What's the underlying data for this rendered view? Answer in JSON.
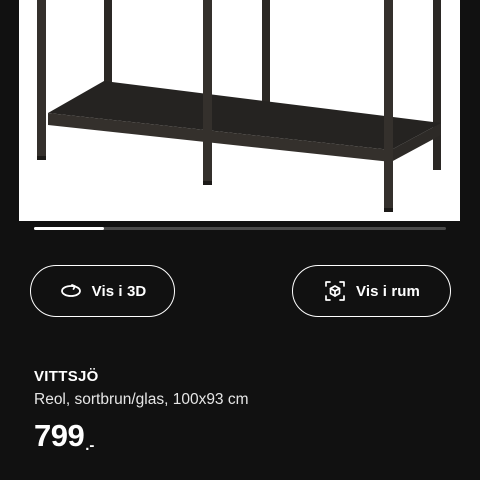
{
  "gallery": {
    "image_alt": "VITTSJÖ shelving unit",
    "progress": 0.17
  },
  "actions": {
    "view_3d": {
      "label": "Vis i 3D",
      "icon": "rotate-3d-icon"
    },
    "view_room": {
      "label": "Vis i rum",
      "icon": "ar-room-icon"
    }
  },
  "product": {
    "name": "VITTSJÖ",
    "description": "Reol, sortbrun/glas, 100x93 cm",
    "price_main": "799",
    "price_suffix": ".-"
  },
  "colors": {
    "background": "#111111",
    "text": "#ffffff",
    "frame": "#2a2724",
    "shelf": "#1f1d1b"
  }
}
